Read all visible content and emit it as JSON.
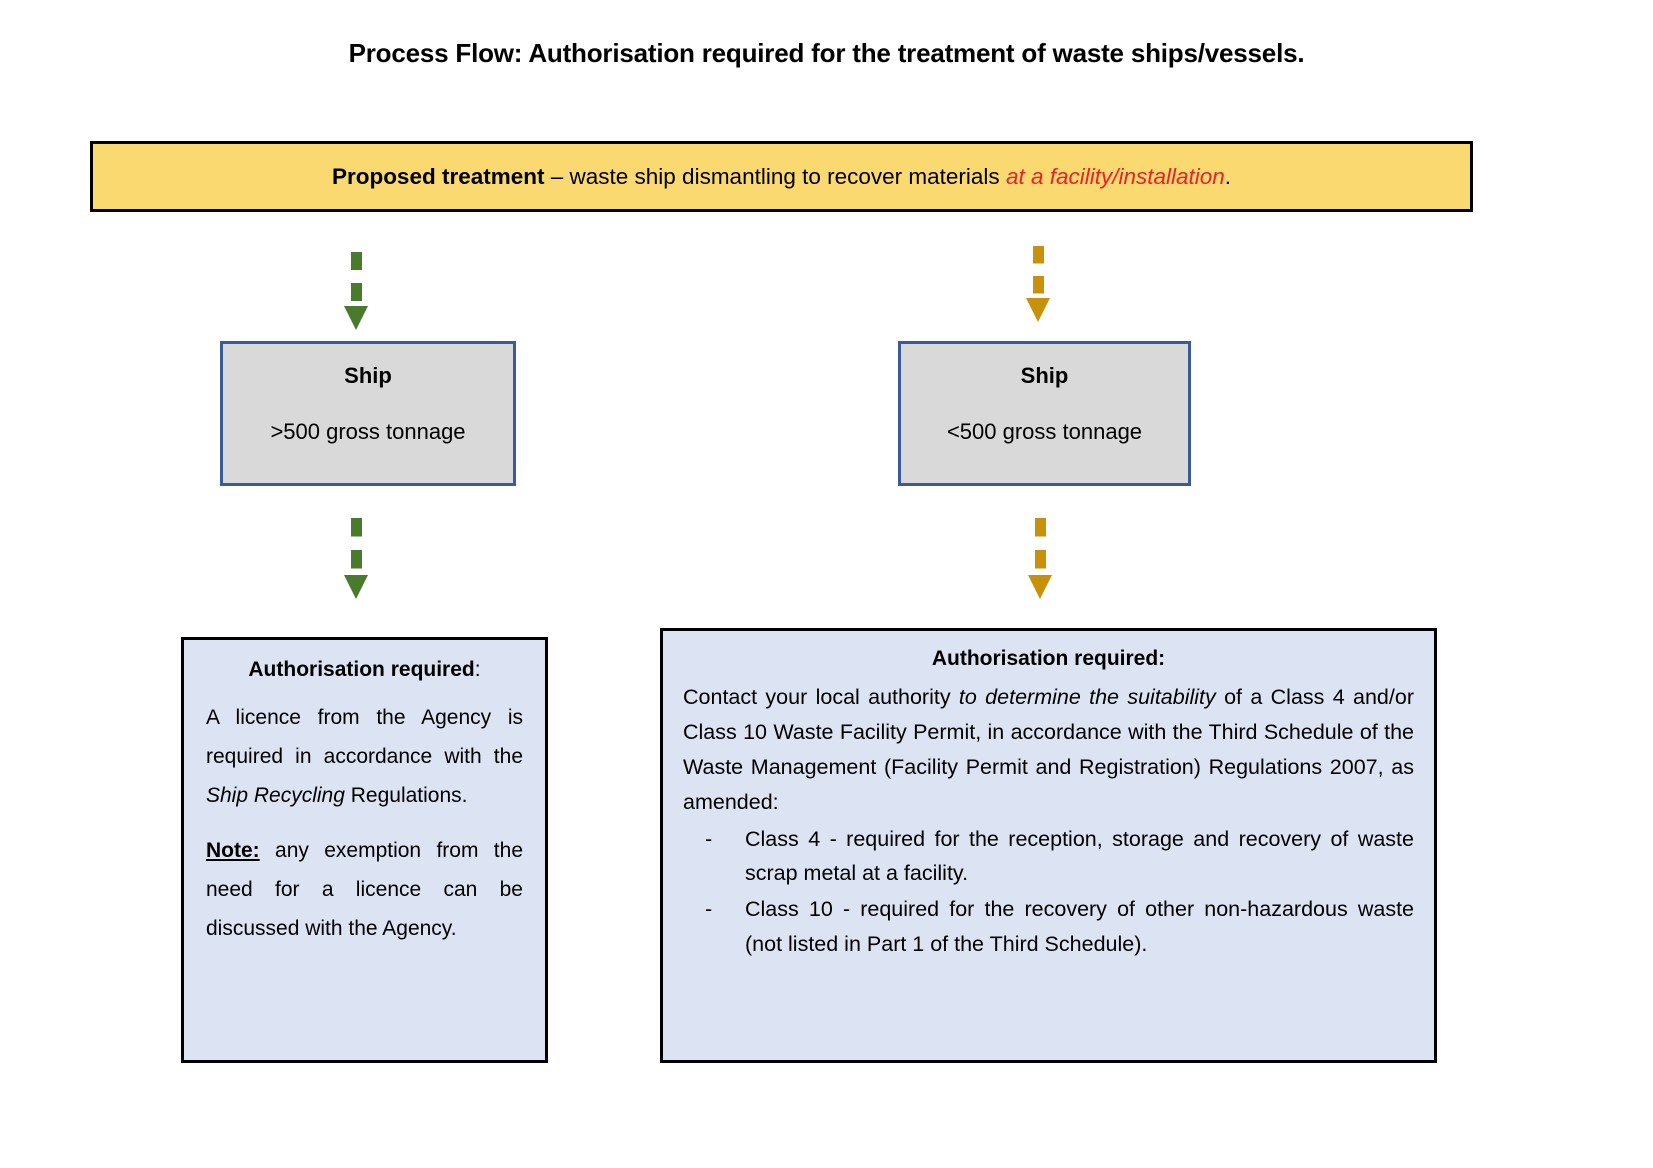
{
  "page": {
    "title": "Process Flow: Authorisation required for the treatment of waste ships/vessels."
  },
  "banner": {
    "lead": "Proposed treatment",
    "middle": " – waste ship dismantling to recover materials ",
    "emphasis": "at a facility/installation",
    "tail": "."
  },
  "branches": [
    {
      "id": "left",
      "ship": {
        "title": "Ship",
        "tonnage": ">500 gross tonnage"
      },
      "arrow_color": "#4A7A2B",
      "authorisation": {
        "heading_bold": "Authorisation required",
        "heading_tail": ":",
        "paragraph_1_a": "A licence from the Agency is required in accordance with the ",
        "paragraph_1_italic": "Ship Recycling",
        "paragraph_1_b": " Regulations.",
        "note_label": "Note:",
        "note_text": " any exemption from the need for a licence can be discussed with the Agency."
      }
    },
    {
      "id": "right",
      "ship": {
        "title": "Ship",
        "tonnage": "<500 gross tonnage"
      },
      "arrow_color": "#C8910B",
      "authorisation": {
        "heading_bold": "Authorisation required:",
        "heading_tail": "",
        "paragraph_a": "Contact your local authority ",
        "paragraph_italic": "to determine the suitability",
        "paragraph_b": " of a Class 4 and/or Class 10 Waste Facility Permit, in accordance with the Third Schedule of the Waste Management (Facility Permit and Registration) Regulations 2007, as amended:",
        "bullets": [
          {
            "dash": "-",
            "text": "Class 4 - required for the reception, storage and recovery of waste scrap metal at a facility."
          },
          {
            "dash": "-",
            "text": "Class 10 - required for the recovery of other non-hazardous waste (not listed in Part 1 of the Third Schedule)."
          }
        ]
      }
    }
  ],
  "colors": {
    "banner_fill": "#FAD970",
    "banner_border": "#000000",
    "emphasis_red": "#E8212A",
    "ship_fill": "#D9D9D9",
    "ship_border": "#3A5B99",
    "auth_fill": "#DCE3F2",
    "auth_border": "#000000",
    "arrow_green": "#4A7A2B",
    "arrow_amber": "#C8910B"
  }
}
